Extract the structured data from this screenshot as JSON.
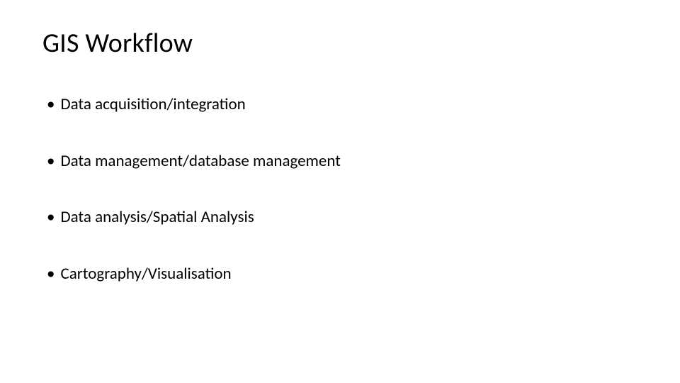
{
  "slide": {
    "title": "GIS Workflow",
    "bullets": [
      {
        "text": "Data acquisition/integration"
      },
      {
        "text": "Data management/database management"
      },
      {
        "text": "Data analysis/Spatial Analysis"
      },
      {
        "text": "Cartography/Visualisation"
      }
    ]
  }
}
